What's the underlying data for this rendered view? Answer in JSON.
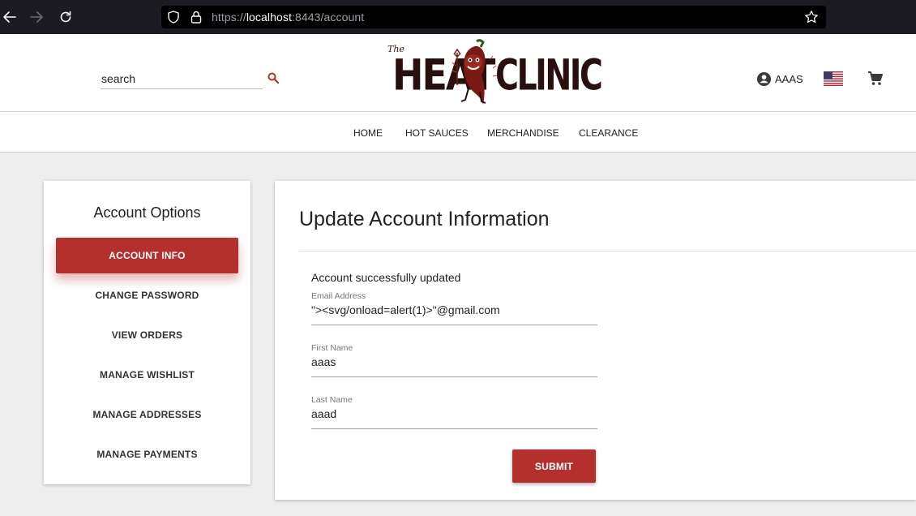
{
  "browser": {
    "url_scheme": "https://",
    "url_host": "localhost",
    "url_rest": ":8443/account",
    "icons": [
      "back-arrow-icon",
      "forward-arrow-icon",
      "reload-icon",
      "shield-icon",
      "lock-icon",
      "star-icon"
    ]
  },
  "header": {
    "search_placeholder": "search",
    "logo_the": "The",
    "logo_heat": "HEAT",
    "logo_clinic": "CLINIC",
    "account_label": "AAAS",
    "icons": [
      "search-icon",
      "account-circle-icon",
      "us-flag-icon",
      "cart-icon"
    ]
  },
  "nav": {
    "items": [
      "HOME",
      "HOT SAUCES",
      "MERCHANDISE",
      "CLEARANCE"
    ]
  },
  "sidebar": {
    "title": "Account Options",
    "items": [
      {
        "label": "ACCOUNT INFO",
        "active": true
      },
      {
        "label": "CHANGE PASSWORD",
        "active": false
      },
      {
        "label": "VIEW ORDERS",
        "active": false
      },
      {
        "label": "MANAGE WISHLIST",
        "active": false
      },
      {
        "label": "MANAGE ADDRESSES",
        "active": false
      },
      {
        "label": "MANAGE PAYMENTS",
        "active": false
      }
    ]
  },
  "main": {
    "title": "Update Account Information",
    "success_message": "Account successfully updated",
    "fields": [
      {
        "label": "Email Address",
        "value": "\"><svg/onload=alert(1)>\"@gmail.com"
      },
      {
        "label": "First Name",
        "value": "aaas"
      },
      {
        "label": "Last Name",
        "value": "aaad"
      }
    ],
    "submit_label": "SUBMIT"
  },
  "colors": {
    "accent": "#b5302c",
    "browser_bar": "#1c1b22",
    "page_bg": "#eeeeee"
  }
}
